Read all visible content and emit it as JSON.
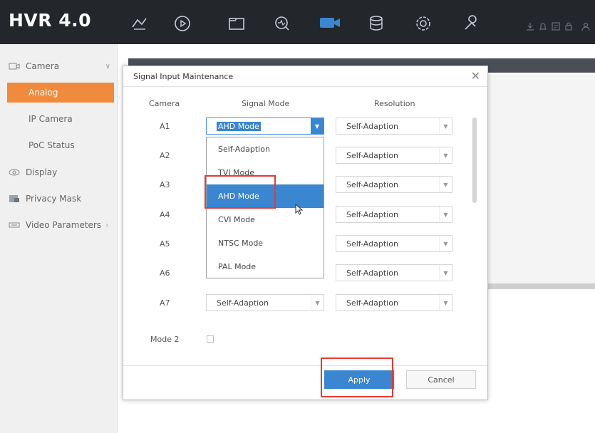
{
  "app": {
    "title": "HVR 4.0"
  },
  "topbar": {
    "icons": [
      "live-view-icon",
      "playback-icon",
      "file-management-icon",
      "smart-analysis-icon",
      "camera-icon",
      "storage-icon",
      "configuration-icon",
      "maintenance-icon"
    ],
    "active_icon": "camera-icon",
    "accent_color": "#3a86d1"
  },
  "sidebar": {
    "items": [
      {
        "label": "Camera",
        "icon": "camera-icon",
        "expanded": true
      },
      {
        "label": "Analog",
        "active": true
      },
      {
        "label": "IP Camera"
      },
      {
        "label": "PoC Status"
      },
      {
        "label": "Display",
        "icon": "display-icon"
      },
      {
        "label": "Privacy Mask",
        "icon": "privacy-mask-icon"
      },
      {
        "label": "Video Parameters",
        "icon": "video-parameters-icon"
      }
    ],
    "active_color": "#f08a3c"
  },
  "dialog": {
    "title": "Signal Input Maintenance",
    "headers": {
      "camera": "Camera",
      "signal_mode": "Signal Mode",
      "resolution": "Resolution"
    },
    "rows": [
      {
        "camera": "A1",
        "signal_mode": "AHD Mode",
        "resolution": "Self-Adaption"
      },
      {
        "camera": "A2",
        "signal_mode": "",
        "resolution": "Self-Adaption"
      },
      {
        "camera": "A3",
        "signal_mode": "",
        "resolution": "Self-Adaption"
      },
      {
        "camera": "A4",
        "signal_mode": "",
        "resolution": "Self-Adaption"
      },
      {
        "camera": "A5",
        "signal_mode": "",
        "resolution": "Self-Adaption"
      },
      {
        "camera": "A6",
        "signal_mode": "",
        "resolution": "Self-Adaption"
      },
      {
        "camera": "A7",
        "signal_mode": "Self-Adaption",
        "resolution": "Self-Adaption"
      }
    ],
    "dropdown_options": [
      "Self-Adaption",
      "TVI Mode",
      "AHD Mode",
      "CVI Mode",
      "NTSC Mode",
      "PAL Mode"
    ],
    "highlighted_option": "AHD Mode",
    "mode2": {
      "label": "Mode 2",
      "checked": false
    },
    "buttons": {
      "apply": "Apply",
      "cancel": "Cancel"
    }
  }
}
